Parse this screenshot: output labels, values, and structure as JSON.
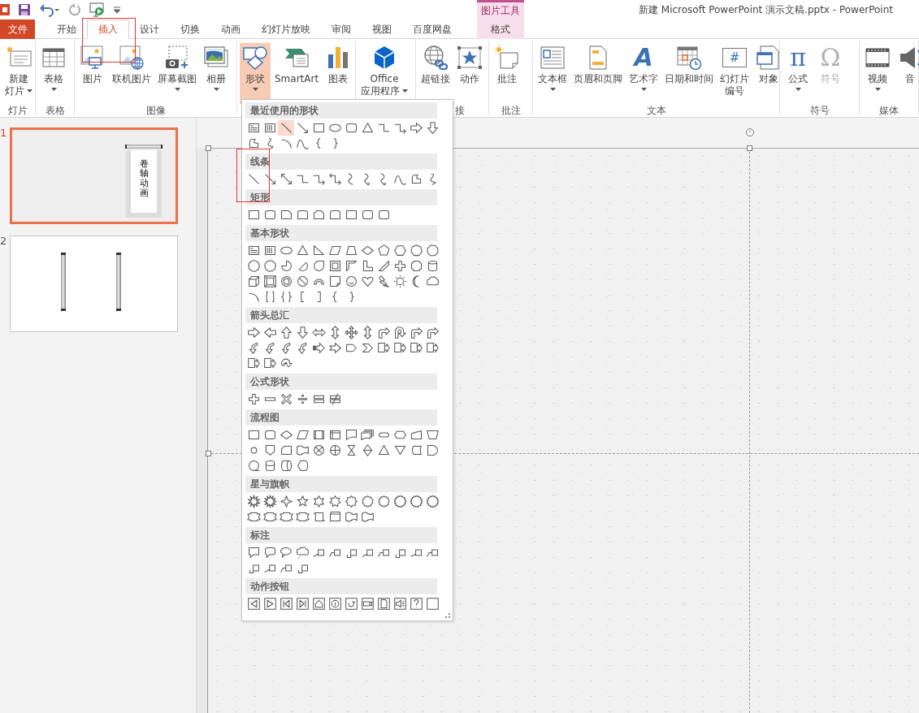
{
  "window": {
    "title": "新建 Microsoft PowerPoint 演示文稿.pptx - PowerPoint"
  },
  "contextual_tab_group": {
    "label": "图片工具"
  },
  "tabs": [
    {
      "label": "文件",
      "kind": "file",
      "selected": false
    },
    {
      "label": "开始",
      "kind": "normal",
      "selected": false
    },
    {
      "label": "插入",
      "kind": "normal",
      "selected": true
    },
    {
      "label": "设计",
      "kind": "normal",
      "selected": false
    },
    {
      "label": "切换",
      "kind": "normal",
      "selected": false
    },
    {
      "label": "动画",
      "kind": "normal",
      "selected": false
    },
    {
      "label": "幻灯片放映",
      "kind": "normal",
      "selected": false
    },
    {
      "label": "审阅",
      "kind": "normal",
      "selected": false
    },
    {
      "label": "视图",
      "kind": "normal",
      "selected": false
    },
    {
      "label": "百度网盘",
      "kind": "normal",
      "selected": false
    },
    {
      "label": "格式",
      "kind": "contextual",
      "selected": false
    }
  ],
  "ribbon_groups": [
    {
      "label": "灯片",
      "buttons": [
        {
          "lines": [
            "新建",
            "灯片"
          ],
          "dropdown": true,
          "pressed": false,
          "disabled": false
        }
      ]
    },
    {
      "label": "表格",
      "buttons": [
        {
          "lines": [
            "表格"
          ],
          "dropdown": true,
          "pressed": false,
          "disabled": false
        }
      ]
    },
    {
      "label": "图像",
      "buttons": [
        {
          "lines": [
            "图片"
          ],
          "dropdown": false,
          "pressed": false,
          "disabled": false
        },
        {
          "lines": [
            "联机图片"
          ],
          "dropdown": false,
          "pressed": false,
          "disabled": false
        },
        {
          "lines": [
            "屏幕截图"
          ],
          "dropdown": true,
          "pressed": false,
          "disabled": false
        },
        {
          "lines": [
            "相册"
          ],
          "dropdown": true,
          "pressed": false,
          "disabled": false
        }
      ]
    },
    {
      "buttons": [
        {
          "lines": [
            "形状"
          ],
          "dropdown": true,
          "pressed": true,
          "disabled": false
        },
        {
          "lines": [
            "SmartArt"
          ],
          "dropdown": false,
          "pressed": false,
          "disabled": false
        },
        {
          "lines": [
            "图表"
          ],
          "dropdown": false,
          "pressed": false,
          "disabled": false
        }
      ]
    },
    {
      "buttons": [
        {
          "lines": [
            "Office",
            "应用程序"
          ],
          "dropdown": true,
          "pressed": false,
          "disabled": false
        }
      ]
    },
    {
      "label": "接",
      "buttons": [
        {
          "lines": [
            "超链接"
          ],
          "dropdown": false,
          "pressed": false,
          "disabled": false
        },
        {
          "lines": [
            "动作"
          ],
          "dropdown": false,
          "pressed": false,
          "disabled": false
        }
      ]
    },
    {
      "label": "批注",
      "buttons": [
        {
          "lines": [
            "批注"
          ],
          "dropdown": false,
          "pressed": false,
          "disabled": false
        }
      ]
    },
    {
      "label": "文本",
      "buttons": [
        {
          "lines": [
            "文本框"
          ],
          "dropdown": true,
          "pressed": false,
          "disabled": false
        },
        {
          "lines": [
            "页眉和页脚"
          ],
          "dropdown": false,
          "pressed": false,
          "disabled": false
        },
        {
          "lines": [
            "艺术字"
          ],
          "glyph": "A",
          "dropdown": true,
          "pressed": false,
          "disabled": false
        },
        {
          "lines": [
            "日期和时间"
          ],
          "dropdown": false,
          "pressed": false,
          "disabled": false
        },
        {
          "lines": [
            "幻灯片",
            "编号"
          ],
          "glyph": "#",
          "dropdown": false,
          "pressed": false,
          "disabled": false
        },
        {
          "lines": [
            "对象"
          ],
          "dropdown": false,
          "pressed": false,
          "disabled": false
        }
      ]
    },
    {
      "label": "符号",
      "buttons": [
        {
          "lines": [
            "公式"
          ],
          "glyph": "π",
          "dropdown": true,
          "pressed": false,
          "disabled": false
        },
        {
          "lines": [
            "符号"
          ],
          "glyph": "Ω",
          "dropdown": false,
          "pressed": false,
          "disabled": true
        }
      ]
    },
    {
      "label": "媒体",
      "buttons": [
        {
          "lines": [
            "视频"
          ],
          "dropdown": true,
          "pressed": false,
          "disabled": false
        },
        {
          "lines": [
            "音"
          ],
          "dropdown": false,
          "pressed": false,
          "disabled": false
        }
      ]
    }
  ],
  "slides": [
    {
      "number": "1",
      "kind": "scroll",
      "caption": "卷轴动画",
      "selected": true
    },
    {
      "number": "2",
      "kind": "rods",
      "selected": false
    }
  ],
  "shapes_menu": {
    "sections": [
      {
        "title": "最近使用的形状",
        "items": [
          {
            "selected": false
          },
          {
            "selected": false
          },
          {
            "selected": true
          },
          {
            "selected": false
          },
          {
            "selected": false
          },
          {
            "selected": false
          },
          {
            "selected": false
          },
          {
            "selected": false
          },
          {
            "selected": false
          },
          {
            "selected": false
          },
          {
            "selected": false
          },
          {
            "selected": false
          },
          {
            "selected": false
          },
          {
            "selected": false
          },
          {
            "selected": false
          },
          {
            "selected": false
          },
          {
            "selected": false
          },
          {
            "selected": false
          }
        ]
      },
      {
        "title": "线条"
      },
      {
        "title": "矩形"
      },
      {
        "title": "基本形状"
      },
      {
        "title": "箭头总汇"
      },
      {
        "title": "公式形状"
      },
      {
        "title": "流程图"
      },
      {
        "title": "星与旗帜"
      },
      {
        "title": "标注"
      },
      {
        "title": "动作按钮"
      }
    ]
  }
}
